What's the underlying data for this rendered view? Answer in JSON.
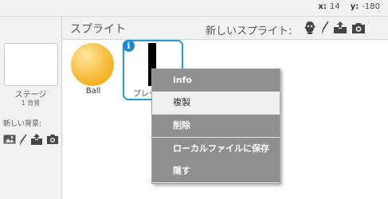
{
  "coords": {
    "x_label": "x:",
    "x_value": "14",
    "y_label": "y:",
    "y_value": "-180"
  },
  "stage": {
    "label": "ステージ",
    "backdrop_count": "1 背景",
    "new_backdrop_label": "新しい背景:"
  },
  "sprites": {
    "title": "スプライト",
    "new_sprite_label": "新しいスプライト:",
    "items": [
      {
        "name": "Ball"
      },
      {
        "name": "プレーヤー"
      }
    ]
  },
  "context_menu": {
    "items": [
      {
        "label": "info"
      },
      {
        "label": "複製"
      },
      {
        "label": "削除"
      },
      {
        "label": "ローカルファイルに保存"
      },
      {
        "label": "隠す"
      }
    ]
  },
  "colors": {
    "selection": "#1f9fd8",
    "menu_dark": "#8f8f8f"
  },
  "icons": [
    "paintbrush-icon",
    "upload-icon",
    "camera-icon",
    "sprite-library-icon",
    "info-icon"
  ]
}
